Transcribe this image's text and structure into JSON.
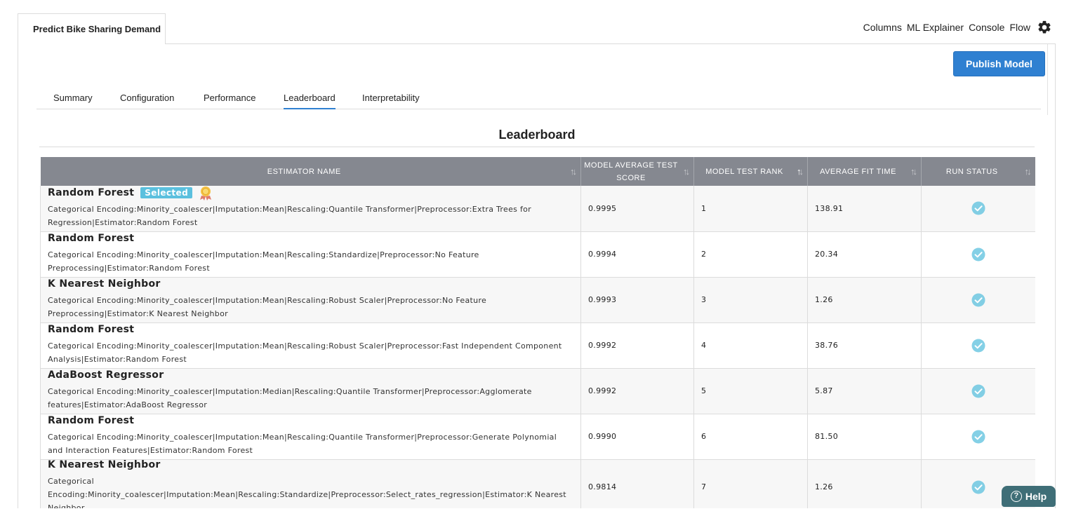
{
  "project": {
    "title": "Predict Bike Sharing Demand"
  },
  "top_nav": {
    "links": [
      "Columns",
      "ML Explainer",
      "Console",
      "Flow"
    ],
    "settings_icon": "gear-icon"
  },
  "publish_button": {
    "label": "Publish Model"
  },
  "tabs": [
    {
      "label": "Summary",
      "active": false
    },
    {
      "label": "Configuration",
      "active": false
    },
    {
      "label": "Performance",
      "active": false
    },
    {
      "label": "Leaderboard",
      "active": true
    },
    {
      "label": "Interpretability",
      "active": false
    }
  ],
  "leaderboard": {
    "title": "Leaderboard",
    "columns": [
      "ESTIMATOR NAME",
      "MODEL AVERAGE TEST SCORE",
      "MODEL TEST RANK",
      "AVERAGE FIT TIME",
      "RUN STATUS"
    ],
    "sorted_column": "MODEL TEST RANK",
    "selected_badge": "Selected",
    "rows": [
      {
        "name": "Random Forest",
        "selected": true,
        "description": "Categorical Encoding:Minority_coalescer|Imputation:Mean|Rescaling:Quantile Transformer|Preprocessor:Extra Trees for Regression|Estimator:Random Forest",
        "score": "0.9995",
        "rank": "1",
        "fit_time": "138.91",
        "status": "completed"
      },
      {
        "name": "Random Forest",
        "selected": false,
        "description": "Categorical Encoding:Minority_coalescer|Imputation:Mean|Rescaling:Standardize|Preprocessor:No Feature Preprocessing|Estimator:Random Forest",
        "score": "0.9994",
        "rank": "2",
        "fit_time": "20.34",
        "status": "completed"
      },
      {
        "name": "K Nearest Neighbor",
        "selected": false,
        "description": "Categorical Encoding:Minority_coalescer|Imputation:Mean|Rescaling:Robust Scaler|Preprocessor:No Feature Preprocessing|Estimator:K Nearest Neighbor",
        "score": "0.9993",
        "rank": "3",
        "fit_time": "1.26",
        "status": "completed"
      },
      {
        "name": "Random Forest",
        "selected": false,
        "description": "Categorical Encoding:Minority_coalescer|Imputation:Mean|Rescaling:Robust Scaler|Preprocessor:Fast Independent Component Analysis|Estimator:Random Forest",
        "score": "0.9992",
        "rank": "4",
        "fit_time": "38.76",
        "status": "completed"
      },
      {
        "name": "AdaBoost Regressor",
        "selected": false,
        "description": "Categorical Encoding:Minority_coalescer|Imputation:Median|Rescaling:Quantile Transformer|Preprocessor:Agglomerate features|Estimator:AdaBoost Regressor",
        "score": "0.9992",
        "rank": "5",
        "fit_time": "5.87",
        "status": "completed"
      },
      {
        "name": "Random Forest",
        "selected": false,
        "description": "Categorical Encoding:Minority_coalescer|Imputation:Mean|Rescaling:Quantile Transformer|Preprocessor:Generate Polynomial and Interaction Features|Estimator:Random Forest",
        "score": "0.9990",
        "rank": "6",
        "fit_time": "81.50",
        "status": "completed"
      },
      {
        "name": "K Nearest Neighbor",
        "selected": false,
        "description": "Categorical Encoding:Minority_coalescer|Imputation:Mean|Rescaling:Standardize|Preprocessor:Select_rates_regression|Estimator:K Nearest Neighbor",
        "score": "0.9814",
        "rank": "7",
        "fit_time": "1.26",
        "status": "completed"
      }
    ]
  },
  "help": {
    "label": "Help"
  },
  "colors": {
    "accent": "#2f80d1",
    "header_bg": "#858890",
    "badge": "#5bc0de",
    "check": "#5bc0de",
    "help_bg": "#3f6e77"
  }
}
